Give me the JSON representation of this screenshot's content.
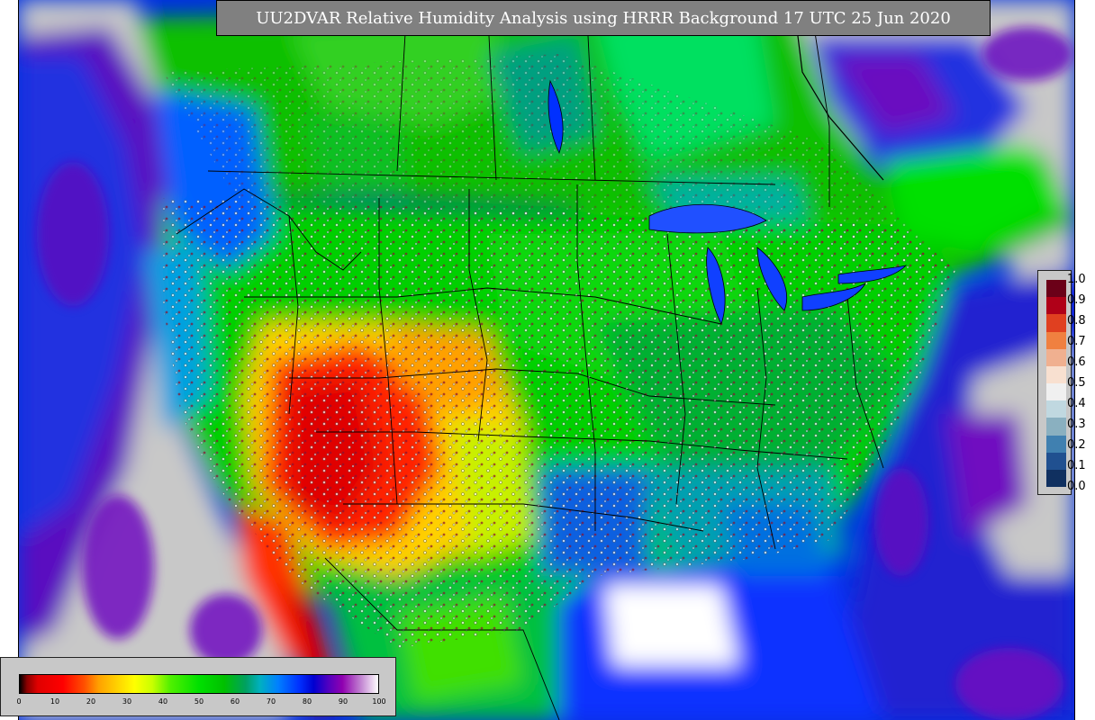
{
  "map": {
    "title": "UU2DVAR Relative Humidity Analysis using HRRR Background 17 UTC 25 Jun 2020",
    "region_description": "Continental United States",
    "variable": "Relative Humidity",
    "colors": {
      "dry_red": "#e00000",
      "orange": "#ffa000",
      "yellow": "#ffff00",
      "green": "#00d000",
      "teal": "#00a0a0",
      "blue": "#0040ff",
      "purple": "#7000b0",
      "gray_masked": "#c8c8c8"
    }
  },
  "innovation_legend": {
    "labels": [
      "1.0",
      "0.9",
      "0.8",
      "0.7",
      "0.6",
      "0.5",
      "0.4",
      "0.3",
      "0.2",
      "0.1",
      "0.0"
    ],
    "colors": [
      "#6b0018",
      "#b00018",
      "#e04020",
      "#f08040",
      "#f0b090",
      "#f8e0d0",
      "#f0f0f0",
      "#c0d8e0",
      "#8ab0c0",
      "#4080b0",
      "#205090",
      "#103060"
    ]
  },
  "rh_legend": {
    "ticks": [
      "0",
      "10",
      "20",
      "30",
      "40",
      "50",
      "60",
      "70",
      "80",
      "90",
      "100"
    ]
  }
}
